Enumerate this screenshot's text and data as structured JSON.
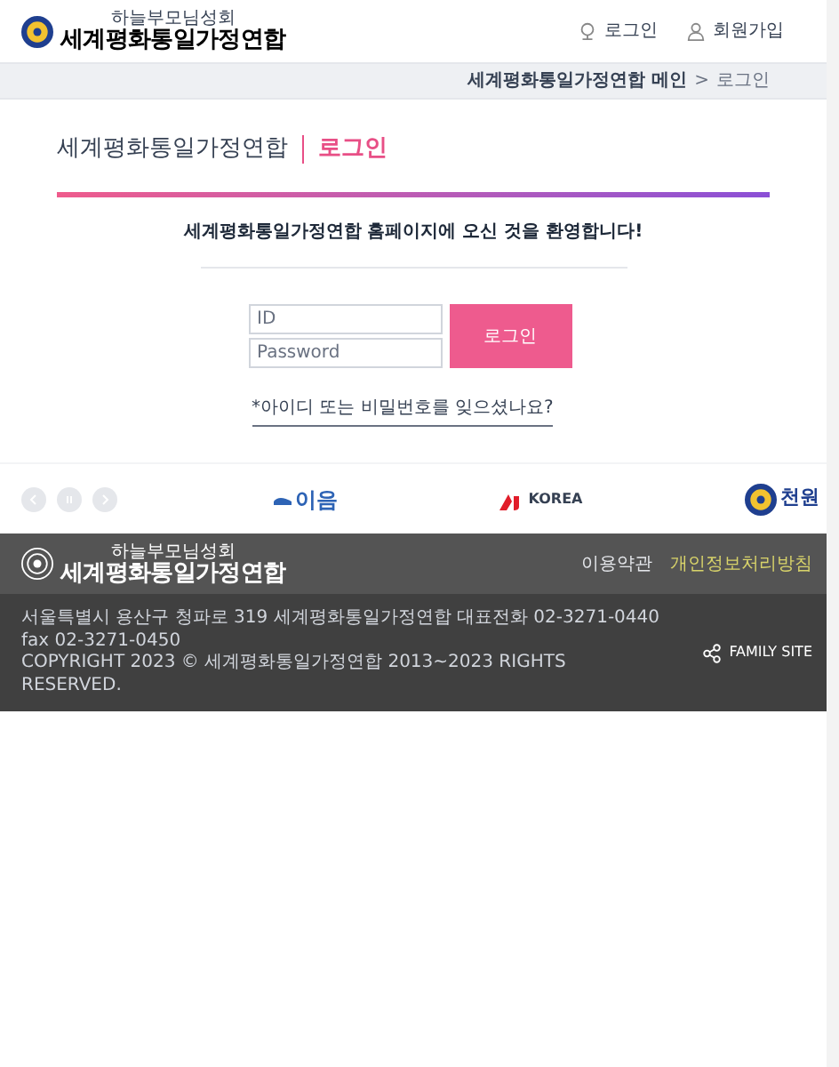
{
  "header": {
    "logo": {
      "subtitle": "하늘부모님성회",
      "title": "세계평화통일가정연합"
    },
    "links": [
      {
        "label": "로그인",
        "kind": "login"
      },
      {
        "label": "회원가입",
        "kind": "join"
      }
    ]
  },
  "breadcrumb": {
    "home": "세계평화통일가정연합 메인",
    "separator": ">",
    "current": "로그인"
  },
  "page_title": {
    "org": "세계평화통일가정연합",
    "current": "로그인"
  },
  "welcome": "세계평화통일가정연합 홈페이지에 오신 것을 환영합니다!",
  "login_form": {
    "id": {
      "placeholder": "ID"
    },
    "password": {
      "placeholder": "Password"
    },
    "submit": "로그인",
    "forgot": "*아이디 또는 비밀번호를 잊으셨나요?"
  },
  "banners": [
    {
      "kind": "ieum",
      "text": "이음"
    },
    {
      "kind": "aj",
      "text": "KOREA"
    },
    {
      "kind": "seal",
      "text": "천원"
    }
  ],
  "footer": {
    "logo": {
      "subtitle": "하늘부모님성회",
      "title": "세계평화통일가정연합"
    },
    "links": [
      {
        "label": "이용약관",
        "highlight": false
      },
      {
        "label": "개인정보처리방침",
        "highlight": true
      }
    ],
    "address": "서울특별시 용산구 청파로 319 세계평화통일가정연합 대표전화 02-3271-0440 fax 02-3271-0450",
    "copyright": "COPYRIGHT 2023 © 세계평화통일가정연합 2013~2023 RIGHTS RESERVED.",
    "family_site": "FAMILY SITE"
  }
}
